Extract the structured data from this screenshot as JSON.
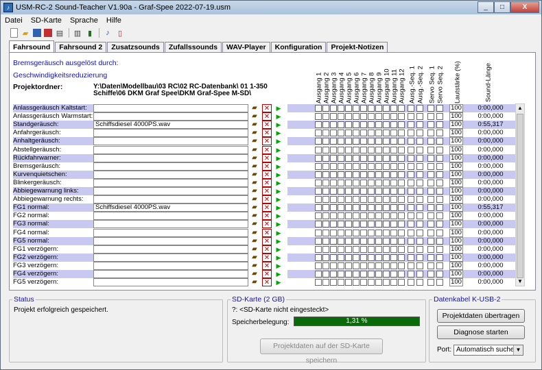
{
  "window": {
    "title": "USM-RC-2 Sound-Teacher V1.90a - Graf-Spee 2022-07-19.usm",
    "minimize": "_",
    "maximize": "□",
    "close": "X"
  },
  "menu": [
    "Datei",
    "SD-Karte",
    "Sprache",
    "Hilfe"
  ],
  "toolbar_icons": [
    "new-file-icon",
    "open-folder-icon",
    "save-icon",
    "save-as-icon",
    "print-icon",
    "import-icon",
    "export-icon",
    "music-note-icon",
    "pdf-icon"
  ],
  "tabs": [
    "Fahrsound",
    "Fahrsound 2",
    "Zusatzsounds",
    "Zufallssounds",
    "WAV-Player",
    "Konfiguration",
    "Projekt-Notizen"
  ],
  "active_tab": "Fahrsound",
  "info": {
    "brake_label": "Bremsgeräusch ausgelöst durch:",
    "speed_label": "Geschwindigkeitsreduzierung",
    "project_folder_label": "Projektordner:",
    "project_folder_line1": "Y:\\Daten\\Modellbau\\03 RC\\02 RC-Datenbank\\ 01 1-350",
    "project_folder_line2": "Schiffe\\06 DKM Graf Spee\\DKM Graf-Spee M-SD\\"
  },
  "columns": [
    "Ausgang 1",
    "Ausgang 2",
    "Ausgang 3",
    "Ausgang 4",
    "Ausgang 5",
    "Ausgang 6",
    "Ausgang 7",
    "Ausgang 8",
    "Ausgang 9",
    "Ausgang 10",
    "Ausgang 11",
    "Ausgang 12",
    "Ausg.-Seq. 1",
    "Ausg.-Seq. 2",
    "Servo Seq. 1",
    "Servo Seq. 2",
    "Lautstärke (%)",
    "Sound-Länge"
  ],
  "rows": [
    {
      "label": "Anlassgeräusch Kaltstart:",
      "file": "",
      "volume": "100",
      "length": "0:00,000"
    },
    {
      "label": "Anlassgeräusch Warmstart:",
      "file": "",
      "volume": "100",
      "length": "0:00,000"
    },
    {
      "label": "Standgeräusch:",
      "file": "Schiffsdiesel 4000PS.wav",
      "volume": "100",
      "length": "0:55,317"
    },
    {
      "label": "Anfahrgeräusch:",
      "file": "",
      "volume": "100",
      "length": "0:00,000"
    },
    {
      "label": "Anhaltgeräusch:",
      "file": "",
      "volume": "100",
      "length": "0:00,000"
    },
    {
      "label": "Abstellgeräusch:",
      "file": "",
      "volume": "100",
      "length": "0:00,000"
    },
    {
      "label": "Rückfahrwarner:",
      "file": "",
      "volume": "100",
      "length": "0:00,000"
    },
    {
      "label": "Bremsgeräusch:",
      "file": "",
      "volume": "100",
      "length": "0:00,000"
    },
    {
      "label": "Kurvenquietschen:",
      "file": "",
      "volume": "100",
      "length": "0:00,000"
    },
    {
      "label": "Blinkergeräusch:",
      "file": "",
      "volume": "100",
      "length": "0:00,000"
    },
    {
      "label": "Abbiegewarnung links:",
      "file": "",
      "volume": "100",
      "length": "0:00,000"
    },
    {
      "label": "Abbiegewarnung rechts:",
      "file": "",
      "volume": "100",
      "length": "0:00,000"
    },
    {
      "label": "FG1 normal:",
      "file": "Schiffsdiesel 4000PS.wav",
      "volume": "100",
      "length": "0:55,317"
    },
    {
      "label": "FG2 normal:",
      "file": "",
      "volume": "100",
      "length": "0:00,000"
    },
    {
      "label": "FG3 normal:",
      "file": "",
      "volume": "100",
      "length": "0:00,000"
    },
    {
      "label": "FG4 normal:",
      "file": "",
      "volume": "100",
      "length": "0:00,000"
    },
    {
      "label": "FG5 normal:",
      "file": "",
      "volume": "100",
      "length": "0:00,000"
    },
    {
      "label": "FG1 verzögern:",
      "file": "",
      "volume": "100",
      "length": "0:00,000"
    },
    {
      "label": "FG2 verzögern:",
      "file": "",
      "volume": "100",
      "length": "0:00,000"
    },
    {
      "label": "FG3 verzögern:",
      "file": "",
      "volume": "100",
      "length": "0:00,000"
    },
    {
      "label": "FG4 verzögern:",
      "file": "",
      "volume": "100",
      "length": "0:00,000"
    },
    {
      "label": "FG5 verzögern:",
      "file": "",
      "volume": "100",
      "length": "0:00,000"
    }
  ],
  "status": {
    "title": "Status",
    "text": "Projekt erfolgreich gespeichert."
  },
  "sd": {
    "title": "SD-Karte (2 GB)",
    "card_text": "?: <SD-Karte nicht eingesteckt>",
    "usage_label": "Speicherbelegung:",
    "usage_value": "1,31 %",
    "save_button": "Projektdaten auf der SD-Karte speichern"
  },
  "cable": {
    "title": "Datenkabel K-USB-2",
    "transfer_button": "Projektdaten übertragen",
    "diag_button": "Diagnose starten",
    "port_label": "Port:",
    "port_value": "Automatisch suchen"
  },
  "colors": {
    "row_band": "#c8c8f0",
    "progress": "#0a6a0a",
    "accent_blue": "#1010c0"
  }
}
